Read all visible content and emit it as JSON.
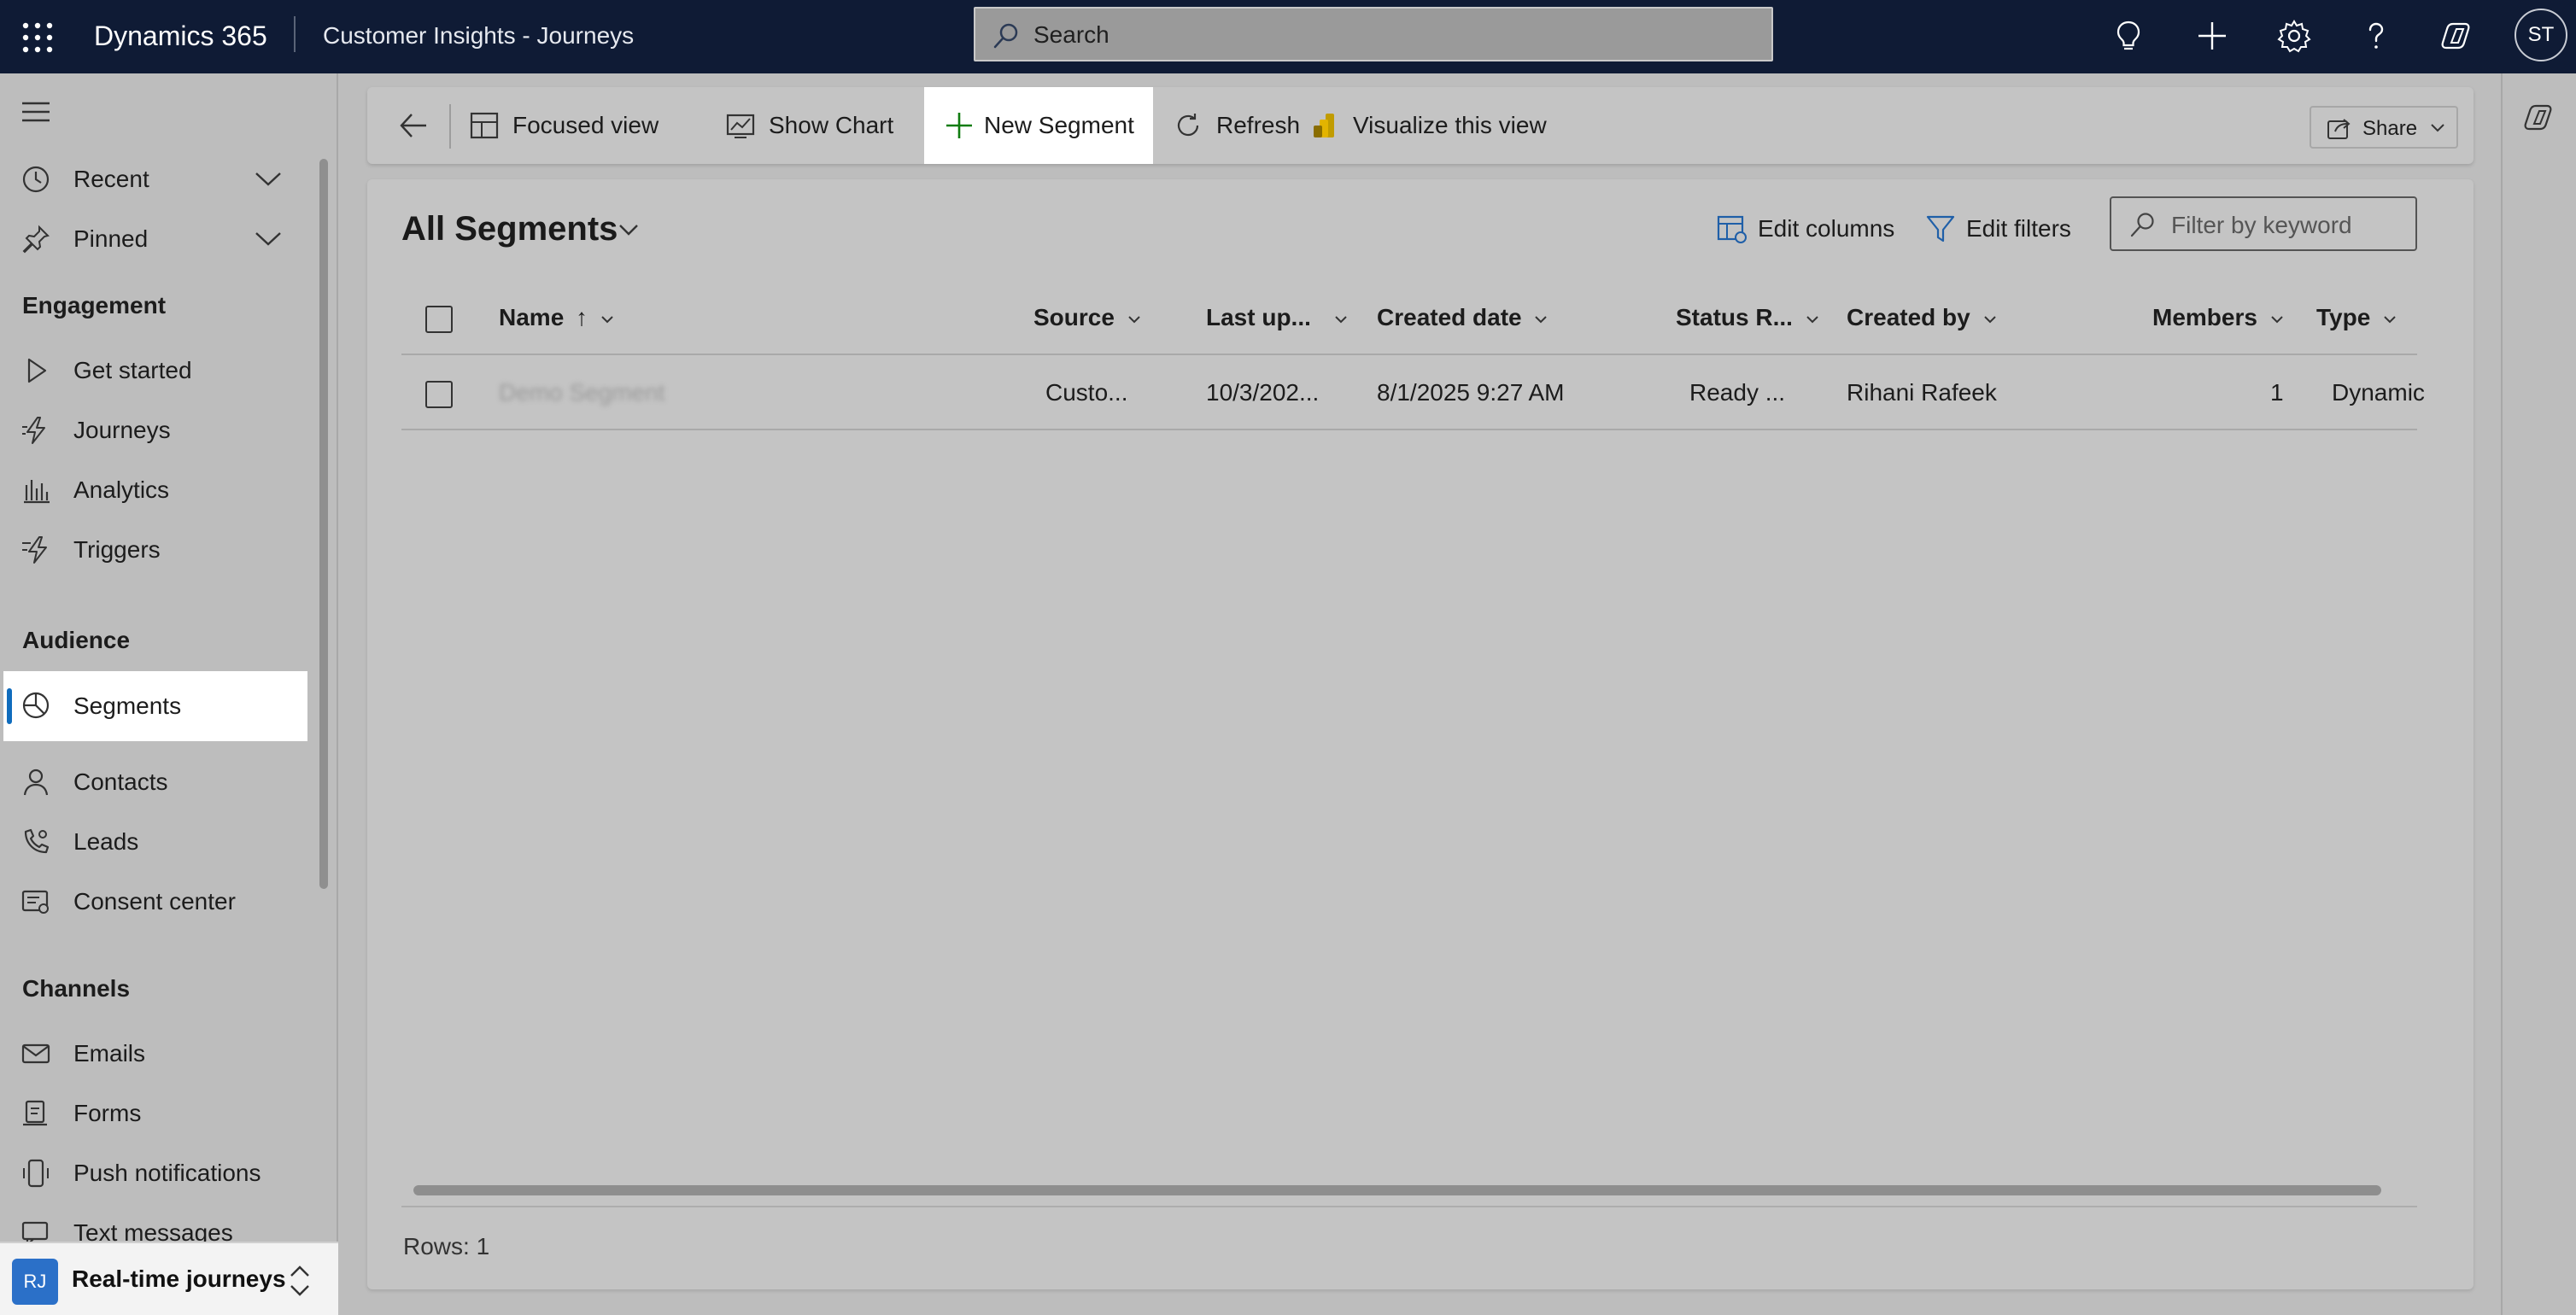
{
  "topbar": {
    "brand": "Dynamics 365",
    "app_name": "Customer Insights - Journeys",
    "search_placeholder": "Search",
    "user_initials": "ST"
  },
  "sidebar": {
    "recent_label": "Recent",
    "pinned_label": "Pinned",
    "sections": {
      "engagement": "Engagement",
      "audience": "Audience",
      "channels": "Channels"
    },
    "engagement_items": [
      {
        "label": "Get started",
        "icon": "play-icon"
      },
      {
        "label": "Journeys",
        "icon": "journey-icon"
      },
      {
        "label": "Analytics",
        "icon": "analytics-icon"
      },
      {
        "label": "Triggers",
        "icon": "trigger-icon"
      }
    ],
    "audience_items": [
      {
        "label": "Segments",
        "icon": "segment-icon",
        "selected": true
      },
      {
        "label": "Contacts",
        "icon": "person-icon"
      },
      {
        "label": "Leads",
        "icon": "phone-person-icon"
      },
      {
        "label": "Consent center",
        "icon": "consent-icon"
      }
    ],
    "channels_items": [
      {
        "label": "Emails",
        "icon": "mail-icon"
      },
      {
        "label": "Forms",
        "icon": "form-icon"
      },
      {
        "label": "Push notifications",
        "icon": "mobile-icon"
      },
      {
        "label": "Text messages",
        "icon": "chat-icon"
      }
    ],
    "area": {
      "initials": "RJ",
      "label": "Real-time journeys"
    }
  },
  "commandbar": {
    "focused_view": "Focused view",
    "show_chart": "Show Chart",
    "new_segment": "New Segment",
    "refresh": "Refresh",
    "visualize": "Visualize this view",
    "share": "Share"
  },
  "view": {
    "title": "All Segments",
    "edit_columns": "Edit columns",
    "edit_filters": "Edit filters",
    "filter_placeholder": "Filter by keyword"
  },
  "grid": {
    "columns": [
      "Name",
      "Source",
      "Last up...",
      "Created date",
      "Status R...",
      "Created by",
      "Members",
      "Type"
    ],
    "name_sort_indicator": "↑",
    "rows": [
      {
        "name": "Demo Segment",
        "source": "Custo...",
        "last_updated": "10/3/202...",
        "created_date": "8/1/2025 9:27 AM",
        "status": "Ready ...",
        "created_by": "Rihani Rafeek",
        "members": "1",
        "type": "Dynamic"
      }
    ],
    "rows_label": "Rows: 1"
  },
  "colors": {
    "topbar_bg": "#0f1b35",
    "accent": "#0f6cbd",
    "new_segment_plus": "#107c10",
    "visualize_icon": "#c19c00",
    "area_badge": "#2b70c8"
  }
}
